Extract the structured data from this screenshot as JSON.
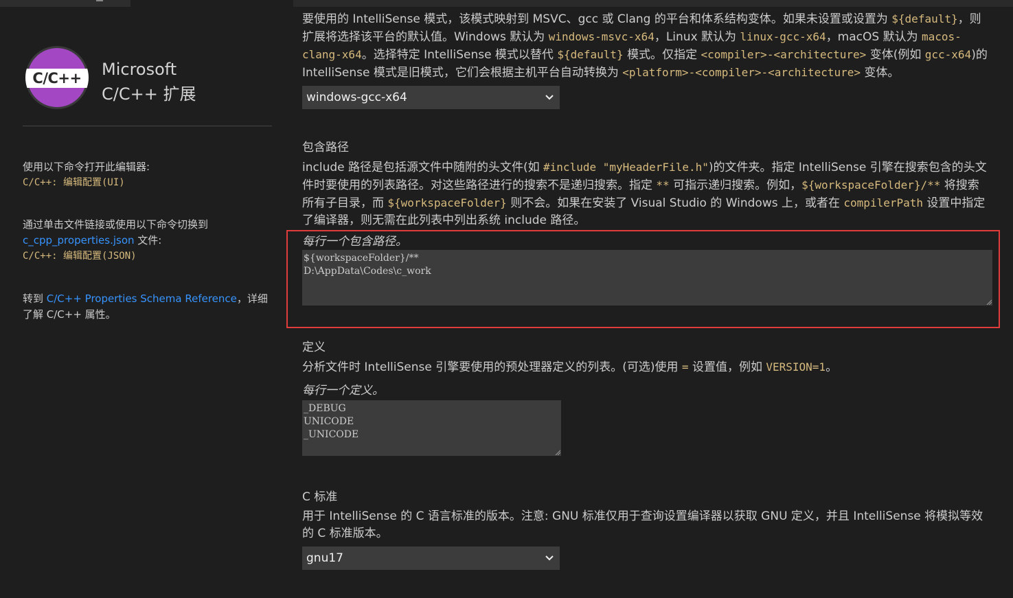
{
  "sidebar": {
    "logo_text": "C/C++",
    "title_line1": "Microsoft",
    "title_line2": "C/C++ 扩展",
    "open_editor_text": "使用以下命令打开此编辑器:",
    "open_editor_cmd": "C/C++: 编辑配置(UI)",
    "switch_text_1": "通过单击文件链接或使用以下命令切换到",
    "switch_link": "c_cpp_properties.json",
    "switch_text_2": " 文件:",
    "switch_cmd": "C/C++: 编辑配置(JSON)",
    "goto_text_1": "转到 ",
    "goto_link": "C/C++ Properties Schema Reference",
    "goto_text_2": "，详细了解 C/C++ 属性。"
  },
  "intellisense": {
    "p1": "要使用的 IntelliSense 模式，该模式映射到 MSVC、gcc 或 Clang 的平台和体系结构变体。如果未设置或设置为 ",
    "c1": "${default}",
    "p2": "，则扩展将选择该平台的默认值。Windows 默认为 ",
    "c2": "windows-msvc-x64",
    "p3": "，Linux 默认为 ",
    "c3": "linux-gcc-x64",
    "p4": "，macOS 默认为 ",
    "c4": "macos-clang-x64",
    "p5": "。选择特定 IntelliSense 模式以替代 ",
    "c5": "${default}",
    "p6": " 模式。仅指定 ",
    "c6": "<compiler>-<architecture>",
    "p7": " 变体(例如 ",
    "c7": "gcc-x64",
    "p8": ")的 IntelliSense 模式是旧模式，它们会根据主机平台自动转换为 ",
    "c8": "<platform>-<compiler>-<architecture>",
    "p9": " 变体。",
    "selected": "windows-gcc-x64"
  },
  "include_path": {
    "heading": "包含路径",
    "p1": "include 路径是包括源文件中随附的头文件(如 ",
    "c1": "#include \"myHeaderFile.h\"",
    "p2": ")的文件夹。指定 IntelliSense 引擎在搜索包含的头文件时要使用的列表路径。对这些路径进行的搜索不是递归搜索。指定 ",
    "c2": "**",
    "p3": " 可指示递归搜索。例如，",
    "c3": "${workspaceFolder}/**",
    "p4": " 将搜索所有子目录，而 ",
    "c4": "${workspaceFolder}",
    "p5": " 则不会。如果在安装了 Visual Studio 的 Windows 上，或者在 ",
    "c5": "compilerPath",
    "p6": " 设置中指定了编译器，则无需在此列表中列出系统 include 路径。",
    "hint": "每行一个包含路径。",
    "lines": [
      "${workspaceFolder}/**",
      "D:\\AppData\\Codes\\c_work"
    ]
  },
  "defines": {
    "heading": "定义",
    "p1": "分析文件时 IntelliSense 引擎要使用的预处理器定义的列表。(可选)使用 ",
    "c1": "=",
    "p2": " 设置值，例如 ",
    "c2": "VERSION=1",
    "p3": "。",
    "hint": "每行一个定义。",
    "lines": [
      "_DEBUG",
      "UNICODE",
      "_UNICODE"
    ]
  },
  "c_standard": {
    "heading": "C 标准",
    "description": "用于 IntelliSense 的 C 语言标准的版本。注意: GNU 标准仅用于查询设置编译器以获取 GNU 定义，并且 IntelliSense 将模拟等效的 C 标准版本。",
    "selected": "gnu17"
  },
  "colors": {
    "background": "#1e1e1e",
    "code": "#d7ba7d",
    "link": "#3794ff",
    "input_bg": "#3c3c3c",
    "highlight_border": "#e03c3c",
    "logo_purple": "#a347c3"
  }
}
